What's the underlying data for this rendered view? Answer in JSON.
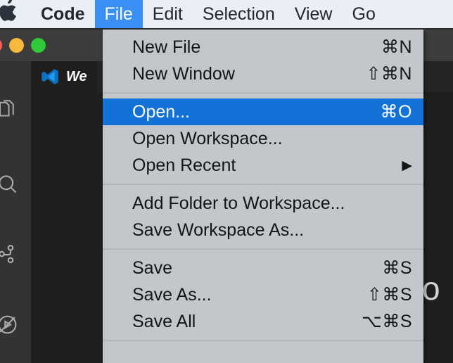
{
  "window": {
    "app_name": "Code",
    "tab_label": "We",
    "ghost_text": "o",
    "traffic_lights": [
      {
        "name": "close",
        "color": "#ff5f57"
      },
      {
        "name": "minimize",
        "color": "#f6b93c"
      },
      {
        "name": "maximize",
        "color": "#2fc93a"
      }
    ],
    "activity_bar": [
      {
        "icon": "explorer-files-icon"
      },
      {
        "icon": "search-icon"
      },
      {
        "icon": "source-control-branch-icon"
      },
      {
        "icon": "run-and-debug-icon"
      }
    ]
  },
  "menubar": {
    "apple_icon": "apple-logo-icon",
    "items": [
      {
        "label": "Code",
        "selected": false,
        "bold": true
      },
      {
        "label": "File",
        "selected": true,
        "bold": false
      },
      {
        "label": "Edit",
        "selected": false,
        "bold": false
      },
      {
        "label": "Selection",
        "selected": false,
        "bold": false
      },
      {
        "label": "View",
        "selected": false,
        "bold": false
      },
      {
        "label": "Go",
        "selected": false,
        "bold": false
      }
    ],
    "highlight_color": "#3b8ef3"
  },
  "file_menu": {
    "highlight_color": "#1272d8",
    "background_color": "#c3c7cb",
    "entries": [
      {
        "type": "item",
        "label": "New File",
        "shortcut": "⌘N",
        "highlighted": false,
        "submenu": false
      },
      {
        "type": "item",
        "label": "New Window",
        "shortcut": "⇧⌘N",
        "highlighted": false,
        "submenu": false
      },
      {
        "type": "separator"
      },
      {
        "type": "item",
        "label": "Open...",
        "shortcut": "⌘O",
        "highlighted": true,
        "submenu": false
      },
      {
        "type": "item",
        "label": "Open Workspace...",
        "shortcut": "",
        "highlighted": false,
        "submenu": false
      },
      {
        "type": "item",
        "label": "Open Recent",
        "shortcut": "",
        "highlighted": false,
        "submenu": true,
        "submenu_glyph": "▶"
      },
      {
        "type": "separator"
      },
      {
        "type": "item",
        "label": "Add Folder to Workspace...",
        "shortcut": "",
        "highlighted": false,
        "submenu": false
      },
      {
        "type": "item",
        "label": "Save Workspace As...",
        "shortcut": "",
        "highlighted": false,
        "submenu": false
      },
      {
        "type": "separator"
      },
      {
        "type": "item",
        "label": "Save",
        "shortcut": "⌘S",
        "highlighted": false,
        "submenu": false
      },
      {
        "type": "item",
        "label": "Save As...",
        "shortcut": "⇧⌘S",
        "highlighted": false,
        "submenu": false
      },
      {
        "type": "item",
        "label": "Save All",
        "shortcut": "⌥⌘S",
        "highlighted": false,
        "submenu": false
      },
      {
        "type": "separator"
      }
    ]
  }
}
